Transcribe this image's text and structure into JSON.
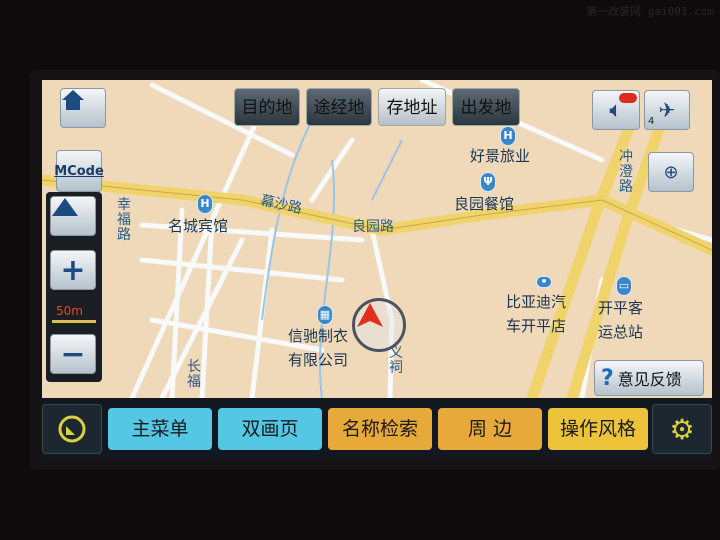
{
  "watermark": "第一改装网 gai001.com",
  "top_buttons": [
    "目的地",
    "途经地",
    "存地址",
    "出发地"
  ],
  "side": {
    "mcode": "MCode",
    "scale": "50m",
    "satellite_count": "4"
  },
  "feedback": "意见反馈",
  "pois": [
    "好景旅业",
    "良园餐馆",
    "名城宾馆",
    "信驰制衣有限公司",
    "比亚迪汽车开平店",
    "开平客运总站"
  ],
  "poi_lines": {
    "xinchi": [
      "信驰制衣",
      "有限公司"
    ],
    "byd": [
      "比亚迪汽",
      "车开平店"
    ],
    "kaiping": [
      "开平客",
      "运总站"
    ]
  },
  "roads": {
    "mu_sha": "幕沙路",
    "liang_yuan": "良园路",
    "xing_fu": "幸福路",
    "chong_cheng": "冲澄路",
    "chang_fu": "长福",
    "yi_ci": "义祠"
  },
  "bottom_buttons": [
    "主菜单",
    "双画页",
    "名称检索",
    "周 边",
    "操作风格"
  ],
  "colors": {
    "map_bg": "#efd9b8",
    "main_road": "#f0d36a",
    "cyan": "#54c7e4",
    "orange": "#e7a93a",
    "yellow": "#ecc33a"
  }
}
